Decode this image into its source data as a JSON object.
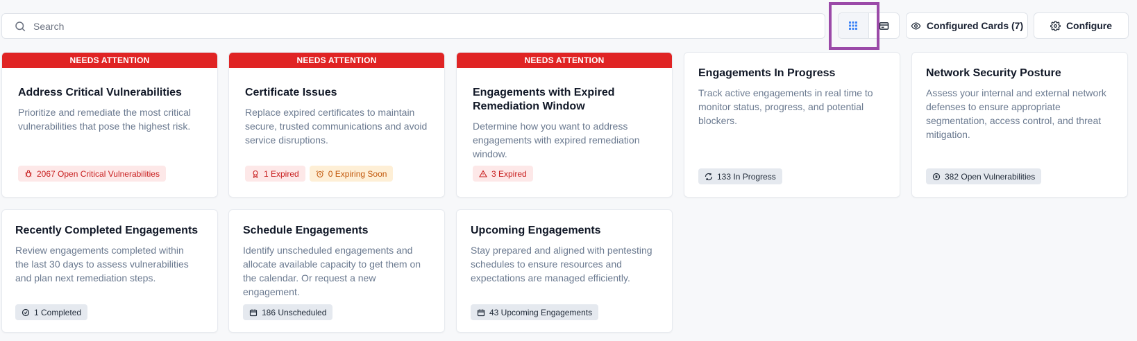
{
  "search": {
    "placeholder": "Search"
  },
  "toolbar": {
    "configured_cards_label": "Configured Cards (7)",
    "configure_label": "Configure"
  },
  "cards": [
    {
      "banner": "NEEDS ATTENTION",
      "title": "Address Critical Vulnerabilities",
      "description": "Prioritize and remediate the most critical vulnerabilities that pose the highest risk.",
      "badges": [
        {
          "icon": "bug-icon",
          "text": "2067 Open Critical Vulnerabilities",
          "color": "red"
        }
      ]
    },
    {
      "banner": "NEEDS ATTENTION",
      "title": "Certificate Issues",
      "description": "Replace expired certificates to maintain secure, trusted communications and avoid service disruptions.",
      "badges": [
        {
          "icon": "certificate-icon",
          "text": "1 Expired",
          "color": "red"
        },
        {
          "icon": "alarm-clock-icon",
          "text": "0 Expiring Soon",
          "color": "orange"
        }
      ]
    },
    {
      "banner": "NEEDS ATTENTION",
      "title": "Engagements with Expired Remediation Window",
      "description": "Determine how you want to address engagements with expired remediation window.",
      "badges": [
        {
          "icon": "warning-triangle-icon",
          "text": "3 Expired",
          "color": "red"
        }
      ]
    },
    {
      "title": "Engagements In Progress",
      "description": "Track active engagements in real time to monitor status, progress, and potential blockers.",
      "badges": [
        {
          "icon": "refresh-icon",
          "text": "133 In Progress",
          "color": "gray"
        }
      ]
    },
    {
      "title": "Network Security Posture",
      "description": "Assess your internal and external network defenses to ensure appropriate segmentation, access control, and threat mitigation.",
      "badges": [
        {
          "icon": "bug-circle-icon",
          "text": "382 Open Vulnerabilities",
          "color": "gray"
        }
      ]
    },
    {
      "title": "Recently Completed Engagements",
      "description": "Review engagements completed within the last 30 days to assess vulnerabilities and plan next remediation steps.",
      "badges": [
        {
          "icon": "check-circle-icon",
          "text": "1 Completed",
          "color": "gray"
        }
      ]
    },
    {
      "title": "Schedule Engagements",
      "description": "Identify unscheduled engagements and allocate available capacity to get them on the calendar. Or request a new engagement.",
      "badges": [
        {
          "icon": "calendar-icon",
          "text": "186 Unscheduled",
          "color": "gray"
        }
      ]
    },
    {
      "title": "Upcoming Engagements",
      "description": "Stay prepared and aligned with pentesting schedules to ensure resources and expectations are managed efficiently.",
      "badges": [
        {
          "icon": "calendar-icon",
          "text": "43 Upcoming Engagements",
          "color": "gray"
        }
      ]
    }
  ]
}
